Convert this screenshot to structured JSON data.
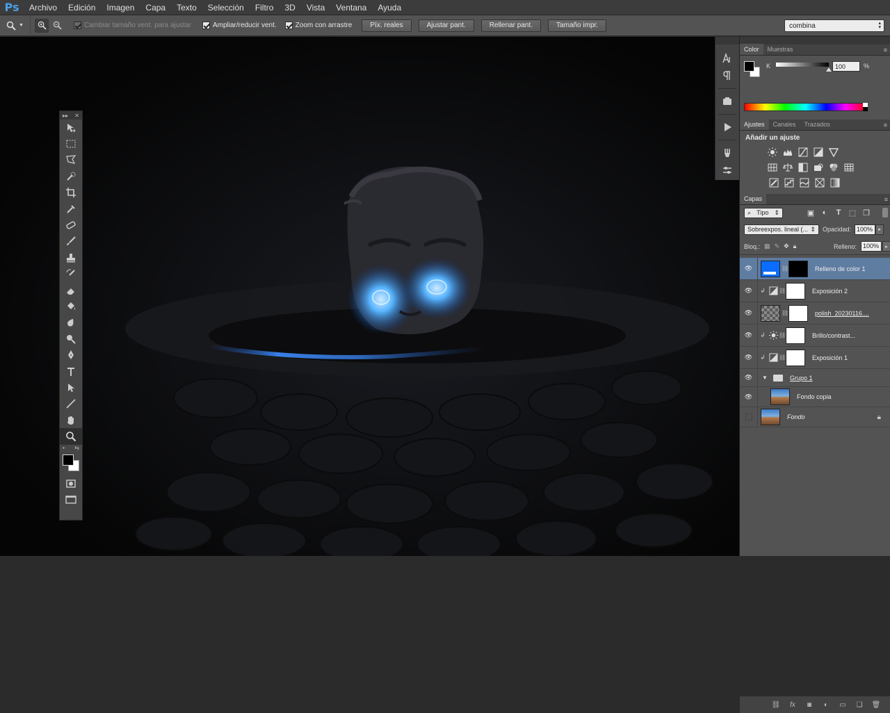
{
  "app": {
    "logo": "Ps"
  },
  "menu": [
    "Archivo",
    "Edición",
    "Imagen",
    "Capa",
    "Texto",
    "Selección",
    "Filtro",
    "3D",
    "Vista",
    "Ventana",
    "Ayuda"
  ],
  "options": {
    "resize_windows": "Cambiar tamaño vent. para ajustar",
    "zoom_all": "Ampliar/reducir vent.",
    "scrubby_zoom": "Zoom con arrastre",
    "actual_pixels": "Píx. reales",
    "fit_screen": "Ajustar pant.",
    "fill_screen": "Rellenar pant.",
    "print_size": "Tamaño impr.",
    "workspace": "combina"
  },
  "color_panel": {
    "tabs": [
      "Color",
      "Muestras"
    ],
    "channel_label": "K",
    "value": "100",
    "unit": "%",
    "foreground": "#000000",
    "background": "#ffffff"
  },
  "adjustments_panel": {
    "tabs": [
      "Ajustes",
      "Canales",
      "Trazados"
    ],
    "title": "Añadir un ajuste"
  },
  "layers_panel": {
    "tab": "Capas",
    "filter_type": "Tipo",
    "blend_mode": "Sobreexpos. lineal (...",
    "opacity_label": "Opacidad:",
    "opacity": "100%",
    "lock_label": "Bloq.:",
    "fill_label": "Relleno:",
    "fill": "100%",
    "layers": [
      {
        "name": "Relleno de color 1",
        "selected": true
      },
      {
        "name": "Exposición 2"
      },
      {
        "name": "polish_20230116...."
      },
      {
        "name": "Brillo/contrast..."
      },
      {
        "name": "Exposición 1"
      },
      {
        "name": "Grupo 1"
      },
      {
        "name": "Fondo copia"
      },
      {
        "name": "Fondo"
      }
    ]
  }
}
